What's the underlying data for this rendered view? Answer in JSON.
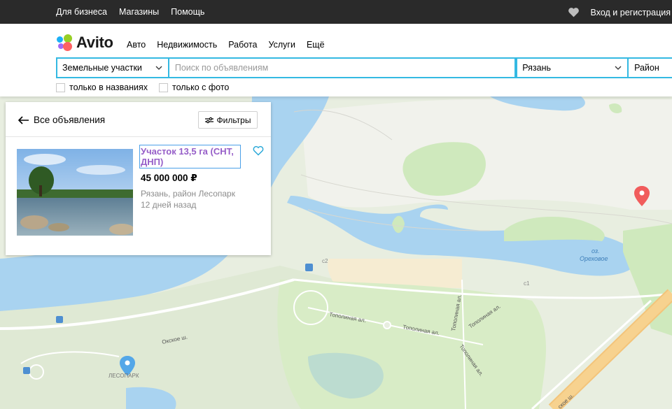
{
  "topbar": {
    "nav": [
      "Для бизнеса",
      "Магазины",
      "Помощь"
    ],
    "login_label": "Вход и регистрация"
  },
  "header": {
    "logo_text": "Avito",
    "categories": [
      "Авто",
      "Недвижимость",
      "Работа",
      "Услуги",
      "Ещё"
    ]
  },
  "search": {
    "category_value": "Земельные участки",
    "query_placeholder": "Поиск по объявлениям",
    "city_value": "Рязань",
    "district_value": "Район",
    "accent_color": "#34b9e2"
  },
  "checkboxes": {
    "titles_only": "только в названиях",
    "with_photo": "только с фото"
  },
  "panel": {
    "back_label": "Все объявления",
    "filters_label": "Фильтры",
    "item": {
      "title": "Участок 13,5 га (СНТ, ДНП)",
      "price": "45 000 000 ₽",
      "location": "Рязань, район Лесопарк",
      "date": "12 дней назад"
    }
  },
  "map": {
    "lake_label_1": "оз.",
    "lake_label_2": "Ореховое",
    "road_labels": {
      "topolinaya": "Тополиная ал.",
      "okskoe": "Окское ш.",
      "okskoe_short": "ское ш."
    },
    "marker_label": "ЛЕСОПАРК",
    "badge_c1": "c1",
    "badge_c2": "c2"
  }
}
